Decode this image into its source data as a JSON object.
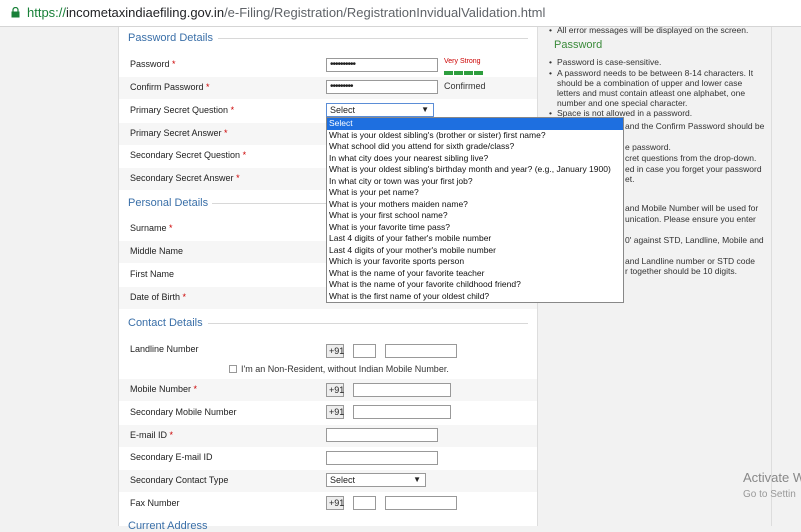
{
  "browser": {
    "url_scheme": "https://",
    "url_domain": "incometaxindiaefiling.gov.in",
    "url_path": "/e-Filing/Registration/RegistrationInvidualValidation.html"
  },
  "password_section": {
    "title": "Password Details",
    "password_label": "Password",
    "password_value": "••••••••••",
    "strength_label": "Very Strong",
    "confirm_label": "Confirm Password",
    "confirm_value": "•••••••••",
    "confirmed_text": "Confirmed",
    "primary_q_label": "Primary Secret Question",
    "primary_q_value": "Select",
    "primary_a_label": "Primary Secret Answer",
    "secondary_q_label": "Secondary Secret Question",
    "secondary_a_label": "Secondary Secret Answer"
  },
  "dropdown": {
    "options": [
      "Select",
      "What is your oldest sibling's (brother or sister) first name?",
      "What school did you attend for sixth grade/class?",
      "In what city does your nearest sibling live?",
      "What is your oldest sibling's birthday month and year? (e.g., January 1900)",
      "In what city or town was your first job?",
      "What is your pet name?",
      "What is your mothers maiden name?",
      "What is your first school name?",
      "What is your favorite time pass?",
      "Last 4 digits of your father's mobile number",
      "Last 4 digits of your mother's mobile number",
      "Which is your favorite sports person",
      "What is the name of your favorite teacher",
      "What is the name of your favorite childhood friend?",
      "What is the first name of your oldest child?"
    ]
  },
  "personal_section": {
    "title": "Personal Details",
    "surname_label": "Surname",
    "middle_label": "Middle Name",
    "first_label": "First Name",
    "dob_label": "Date of Birth"
  },
  "contact_section": {
    "title": "Contact Details",
    "landline_label": "Landline Number",
    "country_code": "+91",
    "nonresident_text": "I'm an Non-Resident, without Indian Mobile Number.",
    "mobile_label": "Mobile Number",
    "secondary_mobile_label": "Secondary Mobile Number",
    "email_label": "E-mail ID",
    "secondary_email_label": "Secondary E-mail ID",
    "secondary_contact_label": "Secondary Contact Type",
    "secondary_contact_value": "Select",
    "fax_label": "Fax Number",
    "current_address_partial": "Current Address"
  },
  "help": {
    "top_item": "All error messages will be displayed on the screen.",
    "password_title": "Password",
    "items": [
      "Password is case-sensitive.",
      "A password needs to be between 8-14 characters. It should be a combination of upper and lower case letters and must contain atleast one alphabet, one number and one special character.",
      "Space is not allowed in a password.",
      "and the Confirm Password should be",
      "e password.",
      "cret questions from the drop-down.",
      "ed in case you forget your password",
      "et.",
      "and Mobile Number will be used for",
      "unication. Please ensure you enter",
      "0' against STD, Landline, Mobile and",
      "and Landline number or STD code",
      "r together should be 10 digits."
    ]
  },
  "watermark": {
    "line1": "Activate W",
    "line2": "Go to Settin"
  }
}
